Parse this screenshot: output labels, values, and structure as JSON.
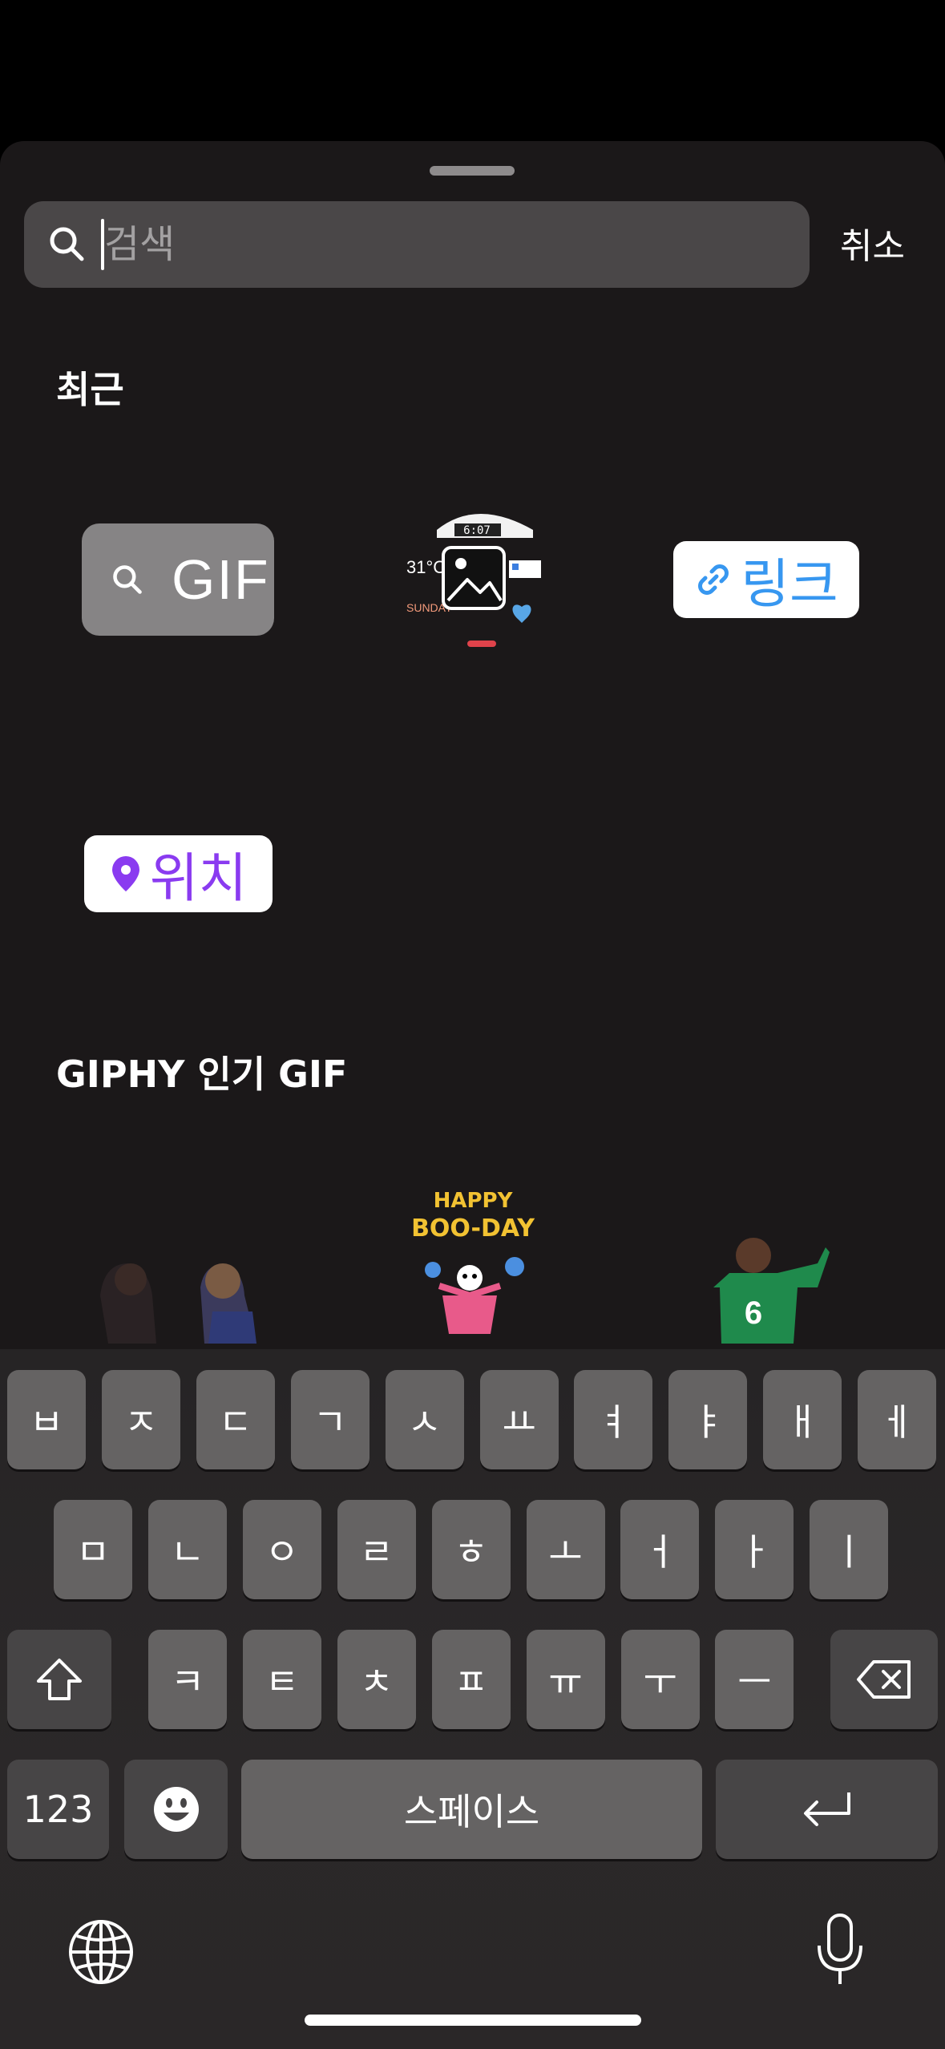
{
  "search": {
    "placeholder": "검색",
    "cancel_label": "취소"
  },
  "sections": {
    "recent_title": "최근",
    "giphy_title": "GIPHY 인기 GIF"
  },
  "recent_stickers": {
    "gif_label": "GIF",
    "link_label": "링크",
    "location_label": "위치",
    "widget": {
      "temperature": "31°C",
      "day": "SUNDAY",
      "clock": "6:07"
    }
  },
  "giphy": {
    "boo_day_line1": "HAPPY",
    "boo_day_line2": "BOO-DAY",
    "jersey_number": "6"
  },
  "keyboard": {
    "row1": [
      "ㅂ",
      "ㅈ",
      "ㄷ",
      "ㄱ",
      "ㅅ",
      "ㅛ",
      "ㅕ",
      "ㅑ",
      "ㅐ",
      "ㅔ"
    ],
    "row2": [
      "ㅁ",
      "ㄴ",
      "ㅇ",
      "ㄹ",
      "ㅎ",
      "ㅗ",
      "ㅓ",
      "ㅏ",
      "ㅣ"
    ],
    "row3": [
      "ㅋ",
      "ㅌ",
      "ㅊ",
      "ㅍ",
      "ㅠ",
      "ㅜ",
      "ㅡ"
    ],
    "numbers_label": "123",
    "space_label": "스페이스"
  },
  "colors": {
    "link": "#3797f0",
    "location": "#8a3bf0",
    "key": "#656363",
    "key_dark": "#474546"
  }
}
